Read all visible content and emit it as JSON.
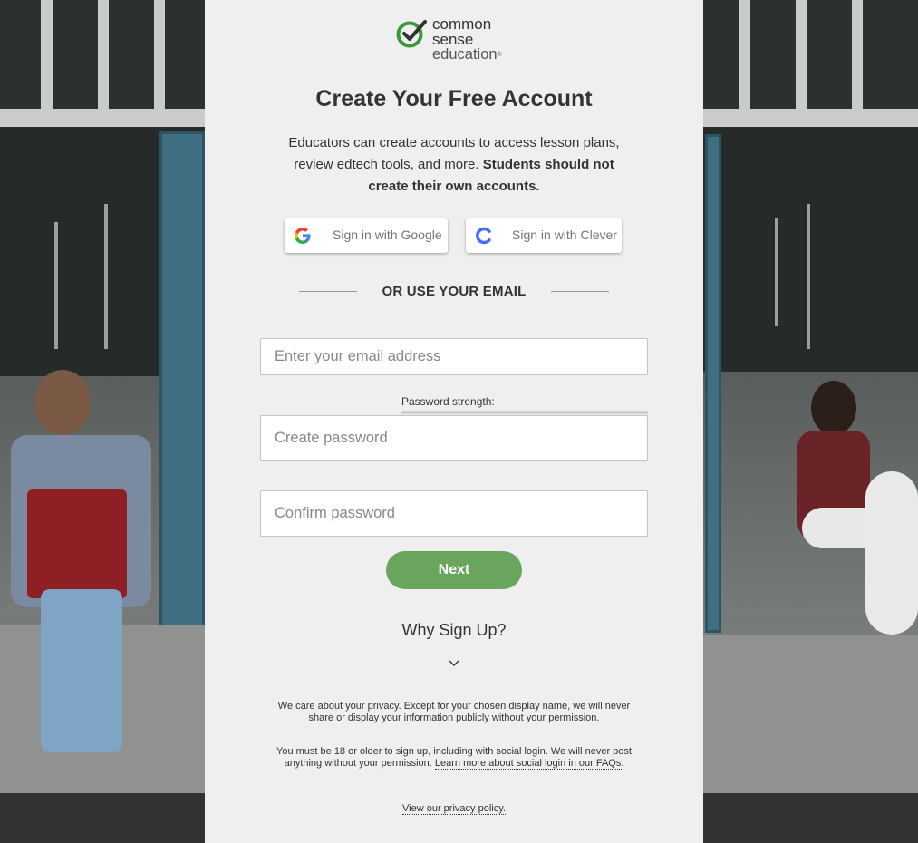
{
  "brand": {
    "line1": "common",
    "line2": "sense",
    "line3": "education",
    "reg_mark": "®",
    "accent_color": "#3a9a3a"
  },
  "page": {
    "title": "Create Your Free Account",
    "intro_text": "Educators can create accounts to access lesson plans, review edtech tools, and more. ",
    "intro_bold": "Students should not create their own accounts."
  },
  "sso": {
    "google_label": "Sign in with Google",
    "clever_label": "Sign in with Clever",
    "google_icon": "google-g-icon",
    "clever_icon": "clever-c-icon"
  },
  "divider_text": "OR USE YOUR EMAIL",
  "form": {
    "email_placeholder": "Enter your email address",
    "email_value": "",
    "password_strength_label": "Password strength:",
    "password_strength": 0,
    "password_placeholder": "Create password",
    "password_value": "",
    "confirm_placeholder": "Confirm password",
    "confirm_value": "",
    "next_label": "Next",
    "next_color": "#6aa55e"
  },
  "why_signup": {
    "label": "Why Sign Up?",
    "icon": "chevron-down-icon"
  },
  "legal": {
    "privacy_note": "We care about your privacy. Except for your chosen display name, we will never share or display your information publicly without your permission.",
    "age_note": "You must be 18 or older to sign up, including with social login. We will never post anything without your permission. ",
    "age_link": "Learn more about social login in our FAQs.",
    "privacy_link": "View our privacy policy."
  }
}
